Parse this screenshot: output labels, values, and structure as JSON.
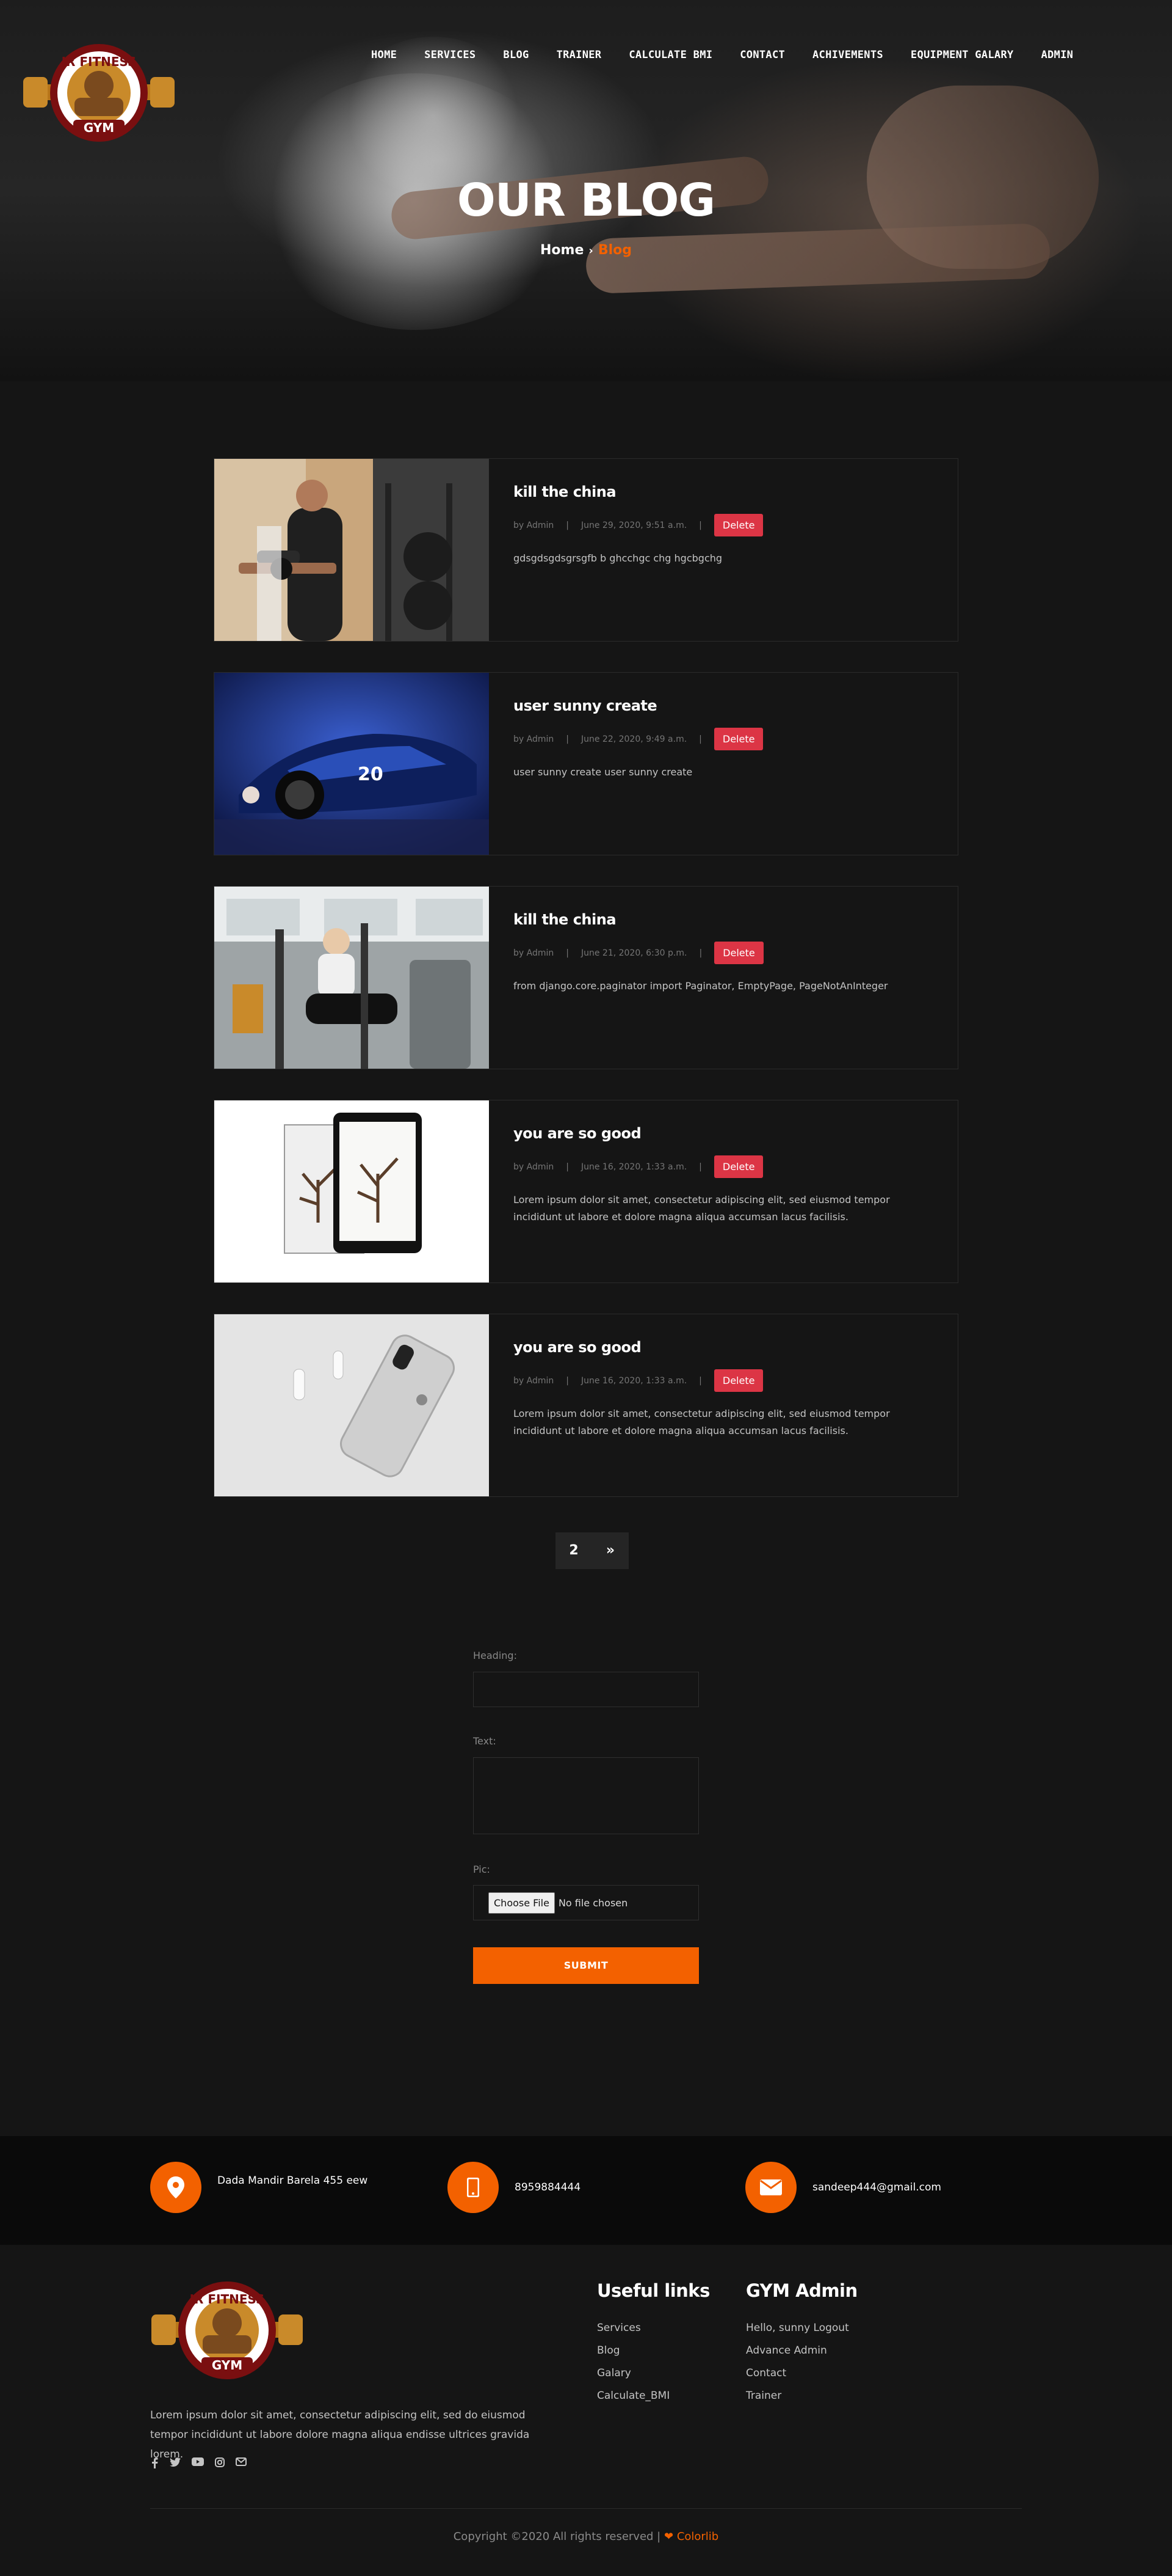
{
  "nav": {
    "items": [
      "HOME",
      "SERVICES",
      "BLOG",
      "TRAINER",
      "CALCULATE BMI",
      "CONTACT",
      "ACHIVEMENTS",
      "EQUIPMENT GALARY",
      "ADMIN"
    ]
  },
  "logo": {
    "top_text": "JR FITNESS",
    "bottom_text": "GYM"
  },
  "hero": {
    "title": "OUR BLOG",
    "breadcrumb_home": "Home",
    "breadcrumb_sep": "›",
    "breadcrumb_current": "Blog"
  },
  "posts": [
    {
      "title": "kill the china",
      "author": "by Admin",
      "date": "June 29, 2020, 9:51 a.m.",
      "delete_label": "Delete",
      "text": "gdsgdsgdsgrsgfb b ghcchgc chg hgcbgchg"
    },
    {
      "title": "user sunny create",
      "author": "by Admin",
      "date": "June 22, 2020, 9:49 a.m.",
      "delete_label": "Delete",
      "text": "user sunny create user sunny create"
    },
    {
      "title": "kill the china",
      "author": "by Admin",
      "date": "June 21, 2020, 6:30 p.m.",
      "delete_label": "Delete",
      "text": "from django.core.paginator import Paginator, EmptyPage, PageNotAnInteger"
    },
    {
      "title": "you are so good",
      "author": "by Admin",
      "date": "June 16, 2020, 1:33 a.m.",
      "delete_label": "Delete",
      "text": "Lorem ipsum dolor sit amet, consectetur adipiscing elit, sed eiusmod tempor incididunt ut labore et dolore magna aliqua accumsan lacus facilisis."
    },
    {
      "title": "you are so good",
      "author": "by Admin",
      "date": "June 16, 2020, 1:33 a.m.",
      "delete_label": "Delete",
      "text": "Lorem ipsum dolor sit amet, consectetur adipiscing elit, sed eiusmod tempor incididunt ut labore et dolore magna aliqua accumsan lacus facilisis."
    }
  ],
  "pagination": {
    "page": "2",
    "next": "»"
  },
  "form": {
    "heading_label": "Heading:",
    "text_label": "Text:",
    "pic_label": "Pic:",
    "file_button": "Choose File",
    "file_status": "No file chosen",
    "submit_label": "SUBMIT"
  },
  "contact": {
    "address": "Dada Mandir Barela 455 eew",
    "phone": "8959884444",
    "email": "sandeep444@gmail.com"
  },
  "footer": {
    "description": "Lorem ipsum dolor sit amet, consectetur adipiscing elit, sed do eiusmod tempor incididunt ut labore dolore magna aliqua endisse ultrices gravida lorem.",
    "useful_links_title": "Useful links",
    "useful_links": [
      "Services",
      "Blog",
      "Galary",
      "Calculate_BMI"
    ],
    "admin_title": "GYM Admin",
    "admin_links": [
      "Hello, sunny Logout",
      "Advance Admin",
      "Contact",
      "Trainer"
    ],
    "copyright": "Copyright ©2020 All rights reserved |",
    "credit": "Colorlib"
  },
  "colors": {
    "accent": "#f36100",
    "delete": "#dc3545",
    "bg": "#151515"
  }
}
